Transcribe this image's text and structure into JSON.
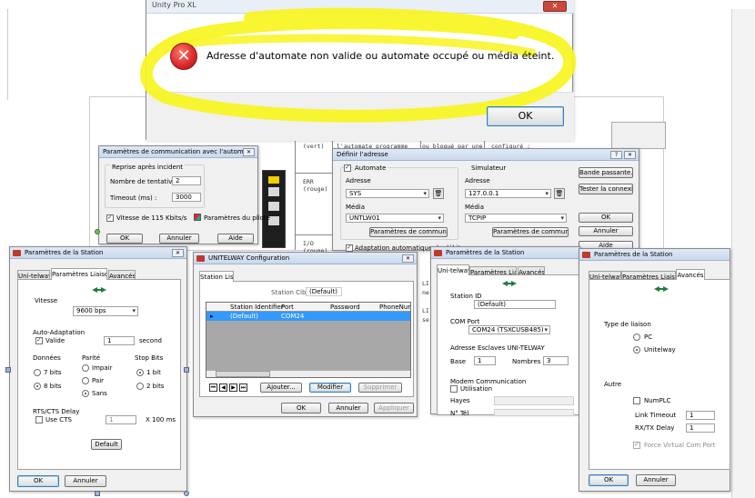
{
  "error": {
    "message": "Adresse d'automate non valide ou automate occupé ou média éteint.",
    "ok": "OK",
    "title_fragment": "Unity Pro XL"
  },
  "comm": {
    "title": "Paramètres de communication avec l'automate",
    "retry_group": "Reprise après incident",
    "retries_label": "Nombre de tentatives :",
    "retries": "2",
    "timeout_label": "Timeout (ms) :",
    "timeout": "3000",
    "speed_label": "Vitesse de 115 Kbits/s",
    "driver_label": "Paramètres du pilote",
    "ok": "OK",
    "cancel": "Annuler",
    "help": "Aide"
  },
  "bg": {
    "vert": "(vert)",
    "err": "ERR",
    "rouge": "(rouge)",
    "io": "I/O",
    "rouge2": "(rouge)",
    "line1": "l'automate  programme",
    "line2": "ou bloqué par une",
    "line3": "configuré :",
    "side1": "LI",
    "side2": "ne",
    "side3": "LI",
    "side4": "se"
  },
  "addr": {
    "title": "Définir l'adresse",
    "plc_group": "Automate",
    "sim_group": "Simulateur",
    "addr_label": "Adresse",
    "plc_addr": "SYS",
    "sim_addr": "127.0.0.1",
    "media_label": "Média",
    "plc_media": "UNTLW01",
    "sim_media": "TCPIP",
    "comm_params": "Paramètres de communication",
    "auto_adapt": "Adaptation automatique du débit",
    "bandwidth": "Bande passante...",
    "test_conn": "Tester la connexion",
    "ok": "OK",
    "cancel": "Annuler",
    "help": "Aide"
  },
  "st1": {
    "title": "Paramètres de la Station",
    "tabs": [
      "Uni-telway",
      "Paramètres Liaison",
      "Avancés"
    ],
    "speed_label": "Vitesse",
    "speed": "9600  bps",
    "auto_label": "Auto-Adaptation",
    "valid": "Valide",
    "second": "second",
    "data_label": "Données",
    "bits7": "7 bits",
    "bits8": "8 bits",
    "parity_label": "Parité",
    "odd": "Impair",
    "even": "Pair",
    "none": "Sans",
    "stop_label": "Stop Bits",
    "stop1": "1 bit",
    "stop2": "2 bits",
    "rts_label": "RTS/CTS Delay",
    "use_cts": "Use CTS",
    "rts_val": "1",
    "x100": "X 100 ms",
    "default": "Default",
    "ok": "OK",
    "cancel": "Annuler",
    "delay": "1"
  },
  "uni": {
    "title": "UNITELWAY Configuration",
    "tab": "Station List",
    "cible_label": "Station Cible :",
    "cible": "(Default)",
    "columns": [
      "Station Identifier",
      "Port",
      "Password",
      "PhoneNumb"
    ],
    "row": {
      "id": "(Default)",
      "port": "COM24"
    },
    "add": "Ajouter...",
    "modify": "Modifier",
    "delete": "Supprimer",
    "ok": "OK",
    "cancel": "Annuler",
    "apply": "Appliquer"
  },
  "st2": {
    "title": "Paramètres de la Station",
    "tabs": [
      "Uni-telway",
      "Paramètres Liaison",
      "Avancés"
    ],
    "id_label": "Station ID",
    "id": "(Default)",
    "port_label": "COM Port",
    "port": "COM24 (TSXCUSB485)",
    "slave_label": "Adresse Esclaves UNI-TELWAY",
    "base_label": "Base",
    "base": "1",
    "count_label": "Nombres",
    "count": "3",
    "modem_label": "Modem Communication",
    "use": "Utilisation",
    "hayes": "Hayes",
    "tel": "N° Tél"
  },
  "st3": {
    "title": "Paramètres de la Station",
    "tabs": [
      "Uni-telway",
      "Paramètres Liaison",
      "Avancés"
    ],
    "type_label": "Type de liaison",
    "pc": "PC",
    "unitelway": "Unitelway",
    "other": "Autre",
    "numplc": "NumPLC",
    "timeout_label": "Link Timeout",
    "timeout": "1",
    "delay_label": "RX/TX Delay",
    "delay": "1",
    "force": "Force Virtual Com Port",
    "ok": "OK",
    "cancel": "Annuler"
  },
  "colors": {
    "highlight": "#f7f41f",
    "error_red": "#d9262a",
    "select_blue": "#3399ff"
  }
}
